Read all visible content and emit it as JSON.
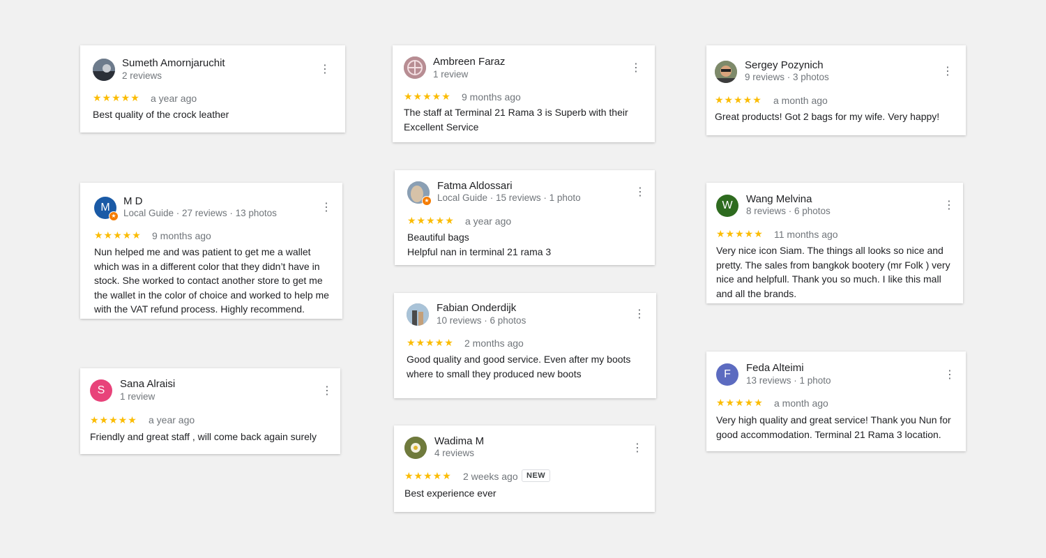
{
  "reviews": [
    {
      "name": "Sumeth Amornjaruchit",
      "meta": "2 reviews",
      "stars": "★★★★★",
      "time": "a year ago",
      "text": "Best quality of the crock leather",
      "avatar_icon": "user-photo-icon"
    },
    {
      "name": "Ambreen Faraz",
      "meta": "1 review",
      "stars": "★★★★★",
      "time": "9 months ago",
      "text": "The staff at Terminal 21 Rama 3 is Superb with their Excellent Service",
      "avatar_icon": "user-photo-icon"
    },
    {
      "name": "Sergey Pozynich",
      "meta": "9 reviews · 3 photos",
      "stars": "★★★★★",
      "time": "a month ago",
      "text": "Great products! Got 2 bags for my wife. Very happy!",
      "avatar_icon": "user-photo-icon"
    },
    {
      "name": "M D",
      "meta": "Local Guide · 27 reviews · 13 photos",
      "stars": "★★★★★",
      "time": "9 months ago",
      "text": "Nun helped me and was patient to get me a wallet which was in a different color that they didn’t have in stock. She worked to contact another store to get me the wallet in the color of choice and worked to help me with the VAT refund process. Highly recommend.",
      "avatar_letter": "M",
      "avatar_color": "#1a5aa6"
    },
    {
      "name": "Fatma Aldossari",
      "meta": "Local Guide · 15 reviews · 1 photo",
      "stars": "★★★★★",
      "time": "a year ago",
      "text": "Beautiful bags\nHelpful nan in terminal 21 rama 3",
      "avatar_icon": "user-photo-icon"
    },
    {
      "name": "Wang Melvina",
      "meta": "8 reviews · 6 photos",
      "stars": "★★★★★",
      "time": "11 months ago",
      "text": "Very nice icon Siam. The things all looks so nice and pretty. The sales from bangkok bootery (mr Folk ) very nice and helpfull. Thank you so much. I like this mall and all the brands.",
      "avatar_letter": "W",
      "avatar_color": "#2e6b1f"
    },
    {
      "name": "Fabian Onderdijk",
      "meta": "10 reviews · 6 photos",
      "stars": "★★★★★",
      "time": "2 months ago",
      "text": "Good quality and good service. Even after my boots where to small they produced new boots",
      "avatar_icon": "user-photo-icon"
    },
    {
      "name": "Sana Alraisi",
      "meta": "1 review",
      "stars": "★★★★★",
      "time": "a year ago",
      "text": "Friendly and great staff , will come back again surely",
      "avatar_letter": "S",
      "avatar_color": "#e8437a"
    },
    {
      "name": "Feda Alteimi",
      "meta": "13 reviews · 1 photo",
      "stars": "★★★★★",
      "time": "a month ago",
      "text": "Very high quality and great service! Thank you Nun for good accommodation. Terminal 21 Rama 3 location.",
      "avatar_letter": "F",
      "avatar_color": "#5c6bc0"
    },
    {
      "name": "Wadima M",
      "meta": "4 reviews",
      "stars": "★★★★★",
      "time": "2 weeks ago",
      "text": "Best experience ever",
      "badge": "NEW",
      "avatar_icon": "user-photo-icon"
    }
  ],
  "icons": {
    "menu": "more-vert-icon",
    "star": "star-icon",
    "local_guide": "local-guide-badge-icon"
  },
  "colors": {
    "star": "#fbbc04",
    "meta": "#70757a",
    "background": "#f1f1f1"
  },
  "glyphs": {
    "menu": "⋮",
    "guide_badge": "★"
  }
}
